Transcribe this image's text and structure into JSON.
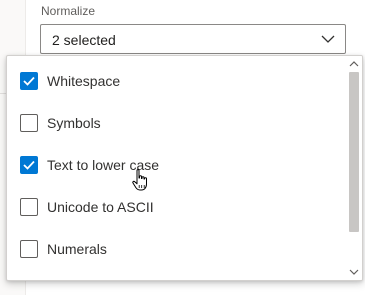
{
  "field": {
    "label": "Normalize",
    "selected_text": "2 selected"
  },
  "options": [
    {
      "label": "Whitespace",
      "checked": true
    },
    {
      "label": "Symbols",
      "checked": false
    },
    {
      "label": "Text to lower case",
      "checked": true
    },
    {
      "label": "Unicode to ASCII",
      "checked": false
    },
    {
      "label": "Numerals",
      "checked": false
    }
  ],
  "icons": {
    "dropdown_indicator": "chevron-down-icon",
    "check": "checkmark-icon",
    "scroll_up": "scroll-up-arrow-icon",
    "scroll_down": "scroll-down-arrow-icon",
    "cursor": "hand-pointer-cursor-icon"
  },
  "colors": {
    "accent": "#0078d4",
    "text": "#323130",
    "border": "#8a8886",
    "scroll_thumb": "#c8c6c4"
  }
}
